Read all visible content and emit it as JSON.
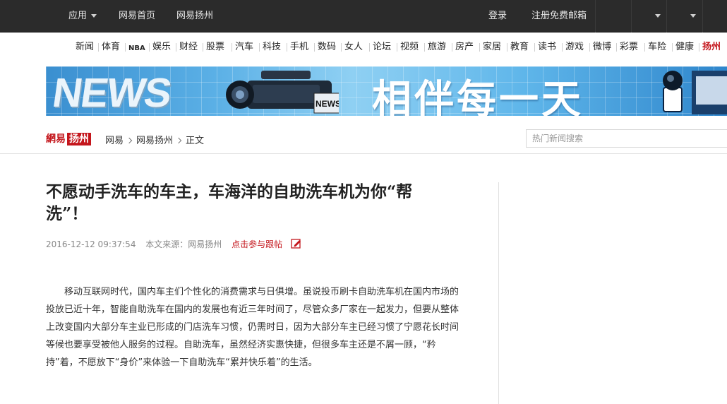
{
  "topbar": {
    "apps_label": "应用",
    "home_label": "网易首页",
    "local_label": "网易扬州",
    "login_label": "登录",
    "register_label": "注册免费邮箱"
  },
  "channels": [
    "新闻",
    "体育",
    "NBA",
    "娱乐",
    "财经",
    "股票",
    "汽车",
    "科技",
    "手机",
    "数码",
    "女人",
    "论坛",
    "视频",
    "旅游",
    "房产",
    "家居",
    "教育",
    "读书",
    "游戏",
    "微博",
    "彩票",
    "车险",
    "健康",
    "扬州"
  ],
  "banner": {
    "news_word": "NEWS",
    "slogan": "相伴每一天",
    "camera_label": "NEWS"
  },
  "logo": {
    "part1": "網易",
    "part2": "扬州"
  },
  "breadcrumb": {
    "level1": "网易",
    "level2": "网易扬州",
    "level3": "正文"
  },
  "search": {
    "placeholder": "热门新闻搜索"
  },
  "article": {
    "title": "不愿动手洗车的车主，车海洋的自助洗车机为你“帮洗”！",
    "datetime": "2016-12-12 09:37:54",
    "source": "本文来源：网易扬州",
    "reply_link": "点击参与跟帖",
    "paragraph": "移动互联网时代，国内车主们个性化的消费需求与日俱增。虽说投币刷卡自助洗车机在国内市场的投放已近十年，智能自助洗车在国内的发展也有近三年时间了，尽管众多厂家在一起发力，但要从整体上改变国内大部分车主业已形成的门店洗车习惯，仍需时日，因为大部分车主已经习惯了宁愿花长时间等候也要享受被他人服务的过程。自助洗车，虽然经济实惠快捷，但很多车主还是不屑一顾，“矜持”着，不愿放下“身价”来体验一下自助洗车“累并快乐着”的生活。"
  },
  "colors": {
    "accent": "#c4161c",
    "topbar": "#2b2b2b"
  }
}
